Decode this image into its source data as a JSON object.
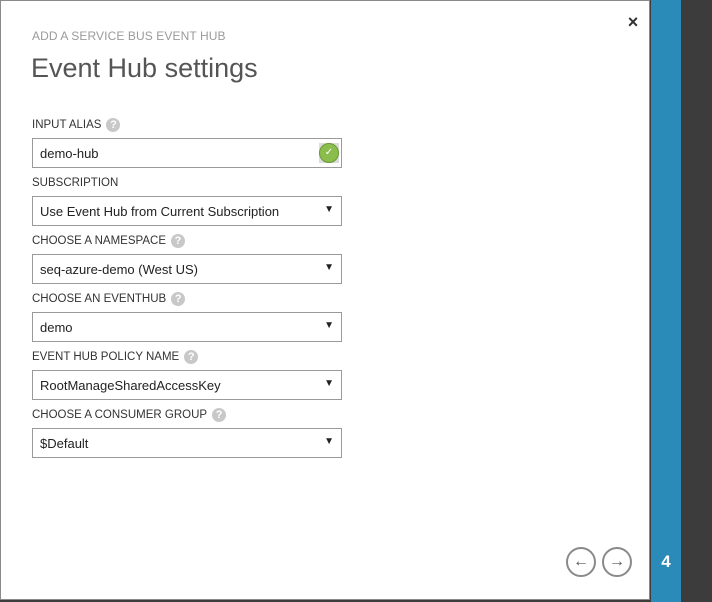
{
  "header": {
    "subtitle": "ADD A SERVICE BUS EVENT HUB",
    "title": "Event Hub settings",
    "close_glyph": "×"
  },
  "fields": {
    "input_alias": {
      "label": "INPUT ALIAS",
      "value": "demo-hub"
    },
    "subscription": {
      "label": "SUBSCRIPTION",
      "value": "Use Event Hub from Current Subscription"
    },
    "namespace": {
      "label": "CHOOSE A NAMESPACE",
      "value": "seq-azure-demo (West US)"
    },
    "eventhub": {
      "label": "CHOOSE AN EVENTHUB",
      "value": "demo"
    },
    "policy": {
      "label": "EVENT HUB POLICY NAME",
      "value": "RootManageSharedAccessKey"
    },
    "consumer_group": {
      "label": "CHOOSE A CONSUMER GROUP",
      "value": "$Default"
    }
  },
  "help_glyph": "?",
  "caret_glyph": "▼",
  "nav": {
    "back_glyph": "←",
    "next_glyph": "→"
  },
  "step": "4",
  "colors": {
    "accent": "#2a8ab8",
    "dark_bg": "#3c3c3c"
  },
  "icons": {
    "close": "close-icon",
    "help": "help-icon",
    "caret": "dropdown-caret-icon",
    "alias_status": "validation-check-icon",
    "back": "arrow-left-icon",
    "next": "arrow-right-icon"
  }
}
